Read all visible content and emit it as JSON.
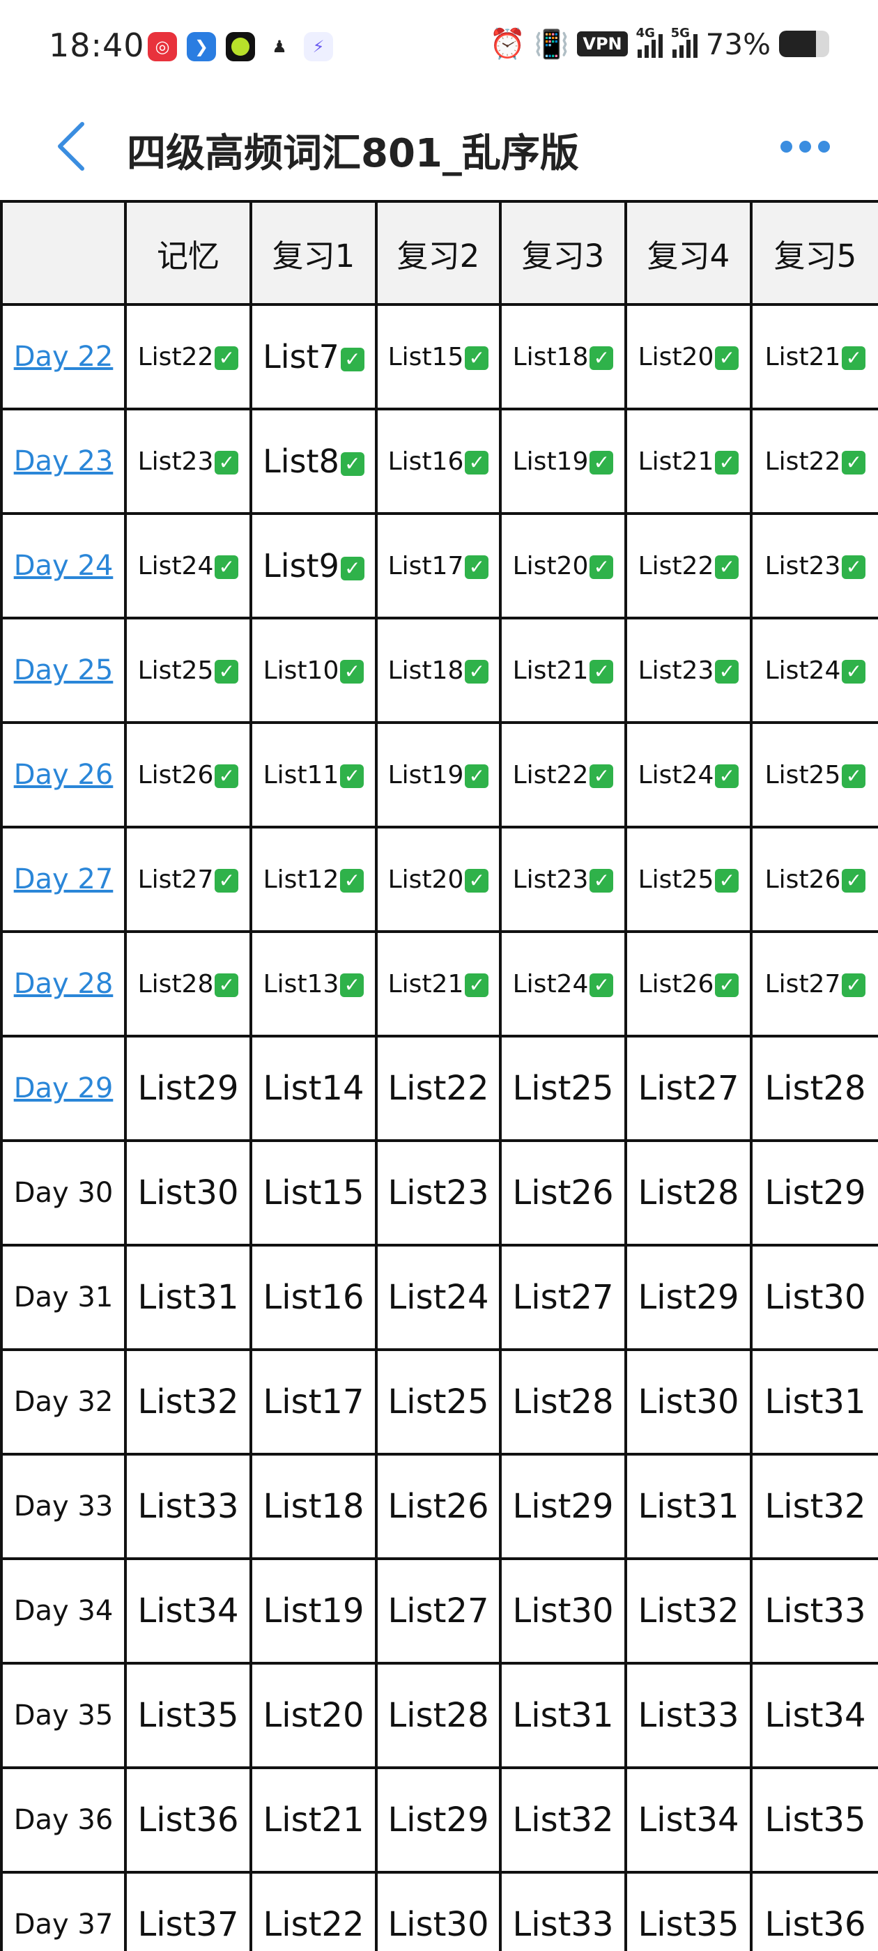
{
  "status_bar": {
    "time": "18:40",
    "battery": "73%",
    "battery_fraction": 0.73,
    "vpn": "VPN",
    "net1": "4G",
    "net2": "5G"
  },
  "header": {
    "title": "四级高频词汇801_乱序版"
  },
  "table": {
    "columns": [
      "",
      "记忆",
      "复习1",
      "复习2",
      "复习3",
      "复习4",
      "复习5"
    ],
    "rows": [
      {
        "day": "Day 22",
        "linked": true,
        "cells": [
          "List22",
          "List7",
          "List15",
          "List18",
          "List20",
          "List21"
        ],
        "done": true
      },
      {
        "day": "Day 23",
        "linked": true,
        "cells": [
          "List23",
          "List8",
          "List16",
          "List19",
          "List21",
          "List22"
        ],
        "done": true
      },
      {
        "day": "Day 24",
        "linked": true,
        "cells": [
          "List24",
          "List9",
          "List17",
          "List20",
          "List22",
          "List23"
        ],
        "done": true
      },
      {
        "day": "Day 25",
        "linked": true,
        "cells": [
          "List25",
          "List10",
          "List18",
          "List21",
          "List23",
          "List24"
        ],
        "done": true
      },
      {
        "day": "Day 26",
        "linked": true,
        "cells": [
          "List26",
          "List11",
          "List19",
          "List22",
          "List24",
          "List25"
        ],
        "done": true
      },
      {
        "day": "Day 27",
        "linked": true,
        "cells": [
          "List27",
          "List12",
          "List20",
          "List23",
          "List25",
          "List26"
        ],
        "done": true
      },
      {
        "day": "Day 28",
        "linked": true,
        "cells": [
          "List28",
          "List13",
          "List21",
          "List24",
          "List26",
          "List27"
        ],
        "done": true
      },
      {
        "day": "Day 29",
        "linked": true,
        "cells": [
          "List29",
          "List14",
          "List22",
          "List25",
          "List27",
          "List28"
        ],
        "done": false
      },
      {
        "day": "Day 30",
        "linked": false,
        "cells": [
          "List30",
          "List15",
          "List23",
          "List26",
          "List28",
          "List29"
        ],
        "done": false
      },
      {
        "day": "Day 31",
        "linked": false,
        "cells": [
          "List31",
          "List16",
          "List24",
          "List27",
          "List29",
          "List30"
        ],
        "done": false
      },
      {
        "day": "Day 32",
        "linked": false,
        "cells": [
          "List32",
          "List17",
          "List25",
          "List28",
          "List30",
          "List31"
        ],
        "done": false
      },
      {
        "day": "Day 33",
        "linked": false,
        "cells": [
          "List33",
          "List18",
          "List26",
          "List29",
          "List31",
          "List32"
        ],
        "done": false
      },
      {
        "day": "Day 34",
        "linked": false,
        "cells": [
          "List34",
          "List19",
          "List27",
          "List30",
          "List32",
          "List33"
        ],
        "done": false
      },
      {
        "day": "Day 35",
        "linked": false,
        "cells": [
          "List35",
          "List20",
          "List28",
          "List31",
          "List33",
          "List34"
        ],
        "done": false
      },
      {
        "day": "Day 36",
        "linked": false,
        "cells": [
          "List36",
          "List21",
          "List29",
          "List32",
          "List34",
          "List35"
        ],
        "done": false
      },
      {
        "day": "Day 37",
        "linked": false,
        "cells": [
          "List37",
          "List22",
          "List30",
          "List33",
          "List35",
          "List36"
        ],
        "done": false
      }
    ]
  },
  "colors": {
    "accent": "#3a8de0",
    "link": "#2a86d8",
    "check": "#2fb24a",
    "header_bg": "#f2f2f2"
  }
}
